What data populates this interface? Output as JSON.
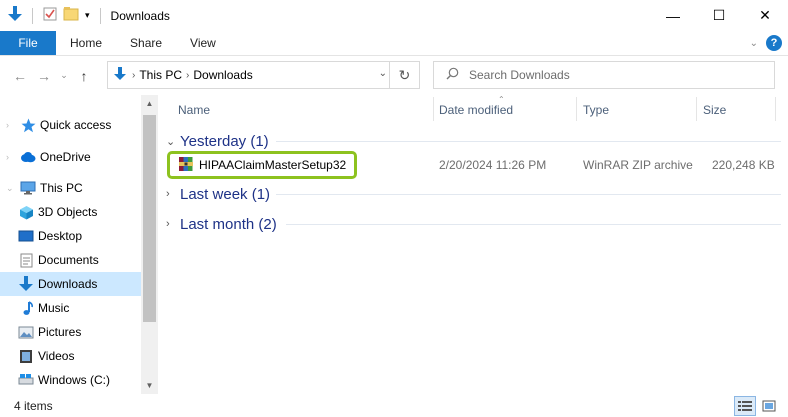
{
  "window": {
    "title": "Downloads",
    "controls": {
      "minimize": "—",
      "maximize": "☐",
      "close": "✕"
    }
  },
  "ribbon": {
    "tabs": [
      "File",
      "Home",
      "Share",
      "View"
    ],
    "help": "?"
  },
  "address": {
    "segments": [
      "This PC",
      "Downloads"
    ]
  },
  "search": {
    "placeholder": "Search Downloads"
  },
  "nav": {
    "items": [
      {
        "label": "Quick access",
        "icon": "star-icon"
      },
      {
        "label": "OneDrive",
        "icon": "cloud-icon"
      },
      {
        "label": "This PC",
        "icon": "computer-icon"
      },
      {
        "label": "3D Objects",
        "icon": "cube-icon"
      },
      {
        "label": "Desktop",
        "icon": "desktop-icon"
      },
      {
        "label": "Documents",
        "icon": "document-icon"
      },
      {
        "label": "Downloads",
        "icon": "download-icon",
        "selected": true
      },
      {
        "label": "Music",
        "icon": "music-icon"
      },
      {
        "label": "Pictures",
        "icon": "pictures-icon"
      },
      {
        "label": "Videos",
        "icon": "videos-icon"
      },
      {
        "label": "Windows (C:)",
        "icon": "drive-icon"
      }
    ]
  },
  "columns": {
    "name": "Name",
    "date_modified": "Date modified",
    "type": "Type",
    "size": "Size"
  },
  "groups": [
    {
      "label": "Yesterday (1)",
      "expanded": true
    },
    {
      "label": "Last week (1)",
      "expanded": false
    },
    {
      "label": "Last month (2)",
      "expanded": false
    }
  ],
  "files": [
    {
      "name": "HIPAAClaimMasterSetup32",
      "date_modified": "2/20/2024 11:26 PM",
      "type": "WinRAR ZIP archive",
      "size": "220,248 KB",
      "highlight_color": "#8dc21f"
    }
  ],
  "status": {
    "items": "4 items"
  },
  "colors": {
    "accent": "#1979ca",
    "selected_bg": "#cce8ff",
    "group_text": "#1e3287",
    "highlight": "#8dc21f"
  }
}
